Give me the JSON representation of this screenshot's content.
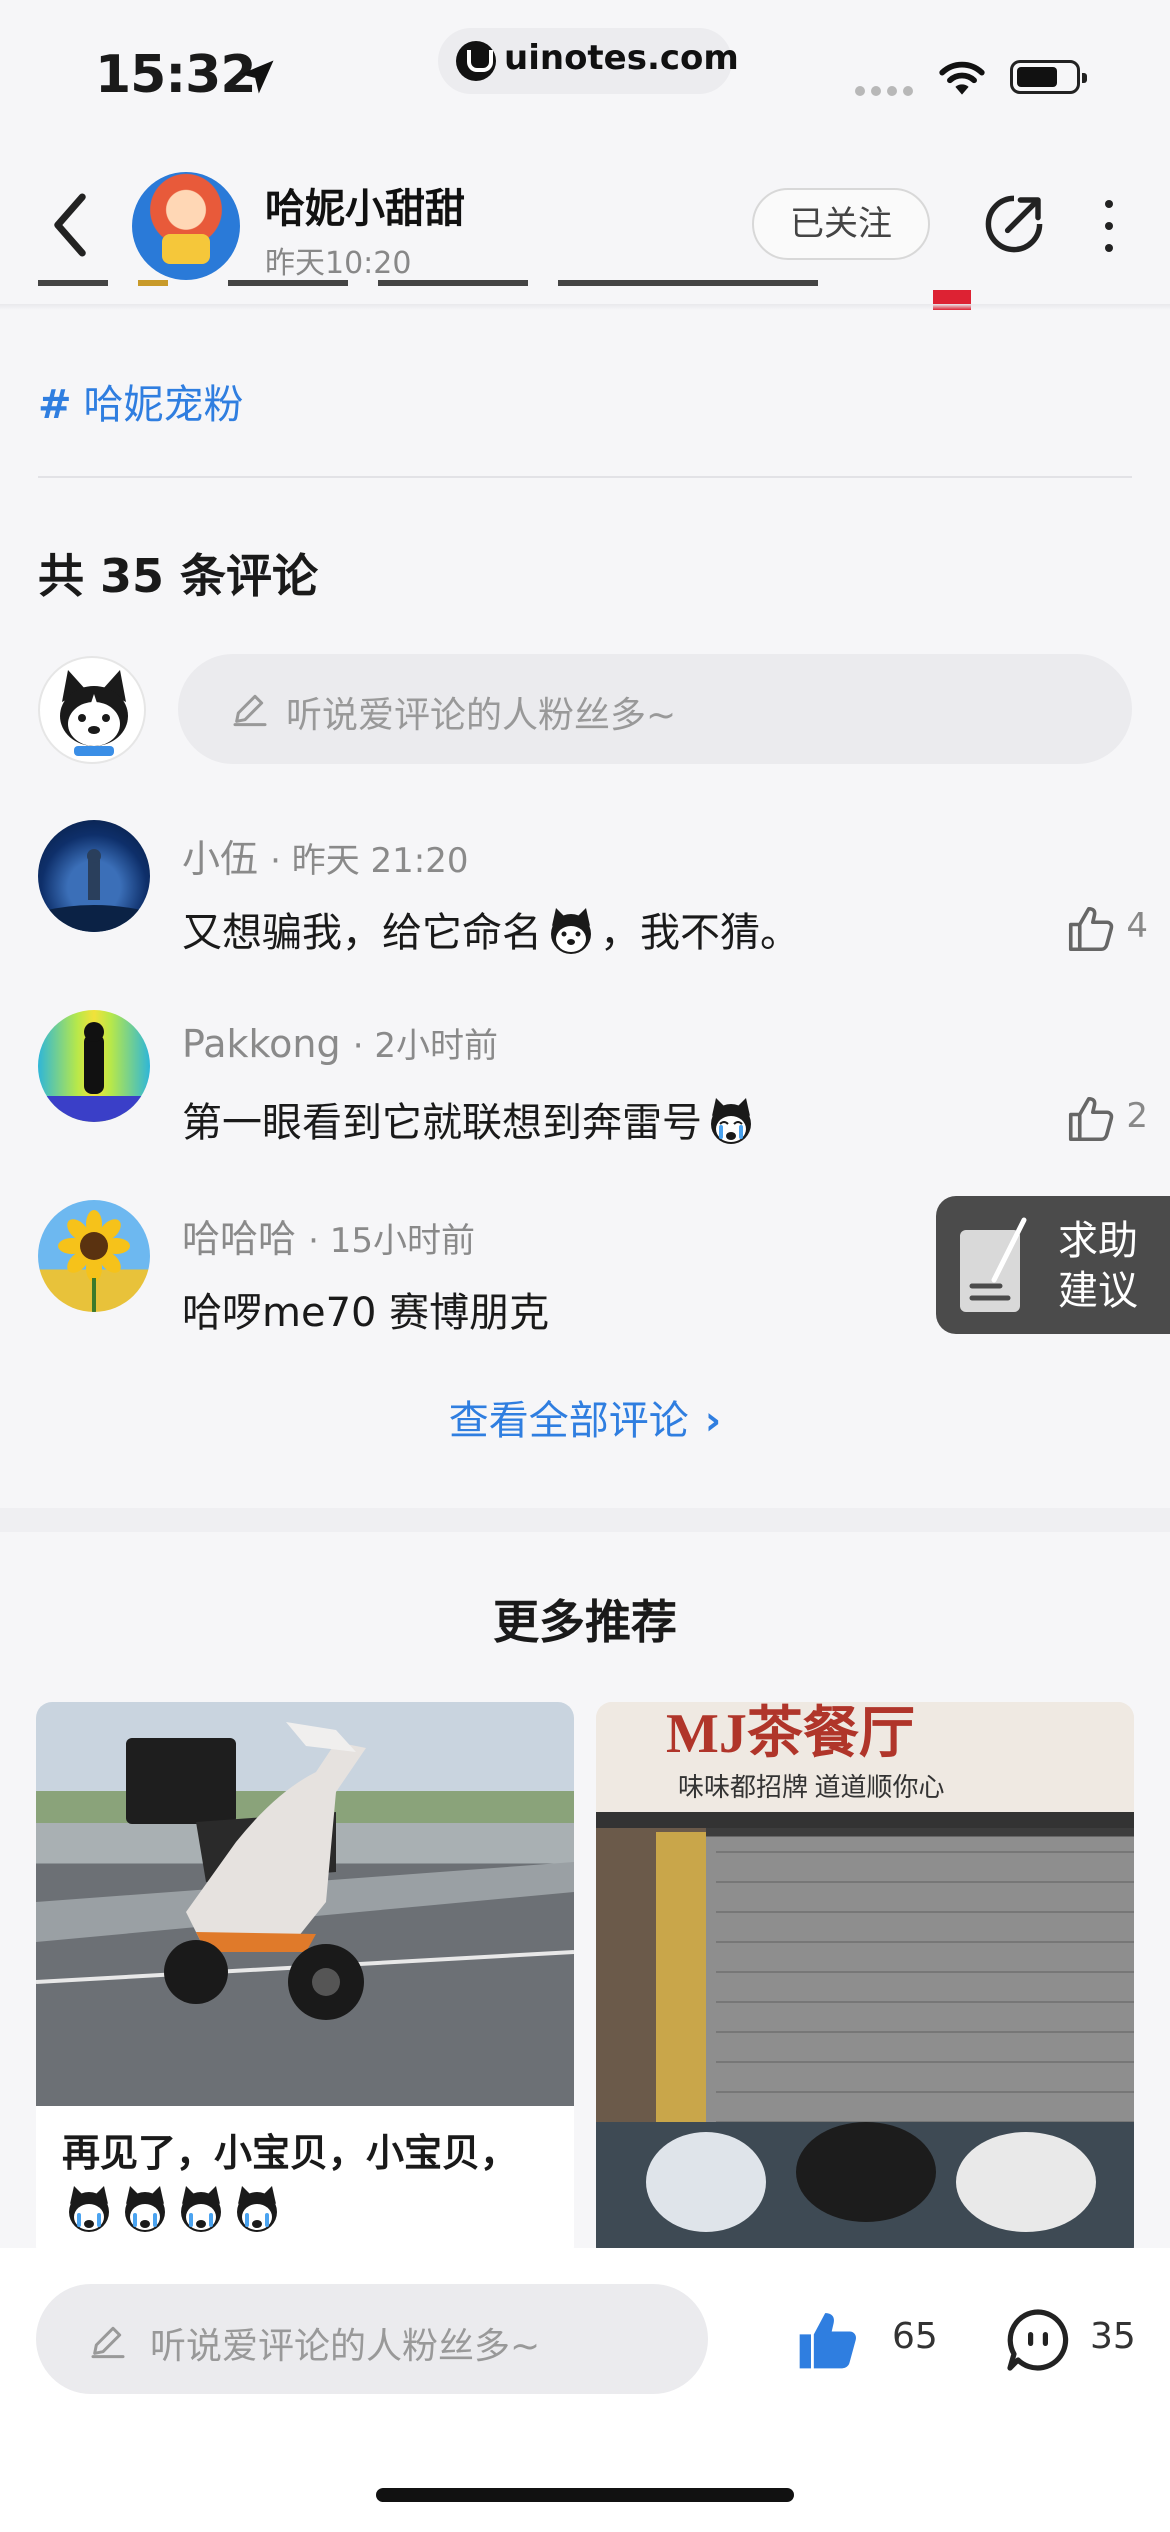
{
  "status_bar": {
    "time": "15:32",
    "url": "uinotes.com"
  },
  "header": {
    "author_name": "哈妮小甜甜",
    "post_time": "昨天10:20",
    "follow_label": "已关注"
  },
  "post": {
    "topic": "哈妮宠粉"
  },
  "comments": {
    "title": "共 35 条评论",
    "input_placeholder": "听说爱评论的人粉丝多~",
    "items": [
      {
        "user": "小伍",
        "time": "· 昨天 21:20",
        "text_before": "又想骗我，给它命名",
        "text_after": "，我不猜。",
        "likes": "4"
      },
      {
        "user": "Pakkong",
        "time": "· 2小时前",
        "text_before": "第一眼看到它就联想到奔雷号",
        "text_after": "",
        "likes": "2"
      },
      {
        "user": "哈哈哈",
        "time": "· 15小时前",
        "text_before": "哈啰me70  赛博朋克",
        "text_after": "",
        "likes": ""
      }
    ],
    "view_all": "查看全部评论"
  },
  "float_help": {
    "line1": "求助",
    "line2": "建议"
  },
  "recommend": {
    "title": "更多推荐",
    "cards": [
      {
        "caption": "再见了，小宝贝，小宝贝，"
      },
      {
        "shop_sign": "MJ茶餐厅",
        "shop_slogan": "味味都招牌  道道顺你心"
      }
    ]
  },
  "bottom_bar": {
    "input_placeholder": "听说爱评论的人粉丝多~",
    "likes": "65",
    "comments": "35"
  },
  "colors": {
    "accent_blue": "#2f7ee0",
    "background": "#f6f6f8",
    "like_blue": "#2f7ee0"
  }
}
